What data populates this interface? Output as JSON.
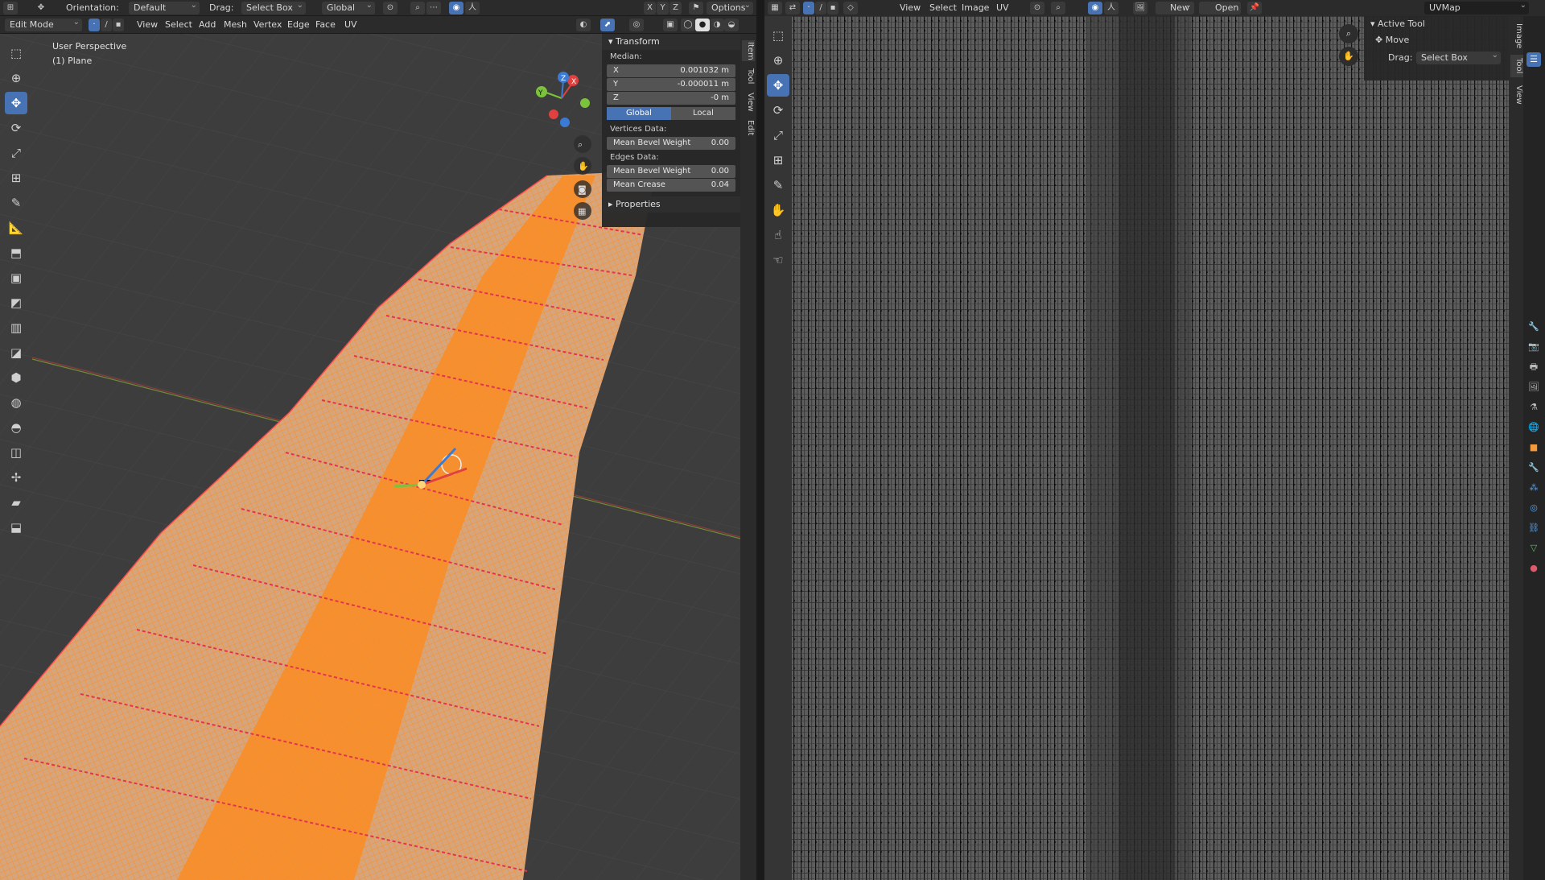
{
  "header": {
    "orientation_label": "Orientation:",
    "orientation_value": "Default",
    "drag_label": "Drag:",
    "drag_value": "Select Box",
    "transform_space": "Global",
    "axes": [
      "X",
      "Y",
      "Z"
    ],
    "options_label": "Options"
  },
  "viewport_header": {
    "mode": "Edit Mode",
    "menus": [
      "View",
      "Select",
      "Add",
      "Mesh",
      "Vertex",
      "Edge",
      "Face",
      "UV"
    ]
  },
  "viewport": {
    "perspective": "User Perspective",
    "object": "(1) Plane",
    "gizmo_axes": [
      "X",
      "Y",
      "Z"
    ]
  },
  "npanel": {
    "transform_title": "Transform",
    "median_label": "Median:",
    "fields": [
      {
        "label": "X",
        "value": "0.001032 m"
      },
      {
        "label": "Y",
        "value": "-0.000011 m"
      },
      {
        "label": "Z",
        "value": "-0 m"
      }
    ],
    "toggle_global": "Global",
    "toggle_local": "Local",
    "vertices_data_label": "Vertices Data:",
    "vertex_bevel": {
      "label": "Mean Bevel Weight",
      "value": "0.00"
    },
    "edges_data_label": "Edges Data:",
    "edge_bevel": {
      "label": "Mean Bevel Weight",
      "value": "0.00"
    },
    "edge_crease": {
      "label": "Mean Crease",
      "value": "0.04"
    },
    "properties_title": "Properties",
    "tabs": [
      "Item",
      "Tool",
      "View",
      "Edit"
    ]
  },
  "uv_header": {
    "menus": [
      "View",
      "Select",
      "Image",
      "UV"
    ],
    "new_label": "New",
    "open_label": "Open",
    "uvmap_name": "UVMap"
  },
  "active_tool": {
    "title": "Active Tool",
    "tool_name": "Move",
    "drag_label": "Drag:",
    "drag_value": "Select Box",
    "tabs": [
      "Image",
      "Tool",
      "View"
    ]
  },
  "colors": {
    "accent": "#4772b3",
    "mesh_orange": "#ff8a1a",
    "seam_red": "#e2344f",
    "viewport_bg": "#3d3d3d",
    "uv_bg": "#5e5e5e"
  }
}
